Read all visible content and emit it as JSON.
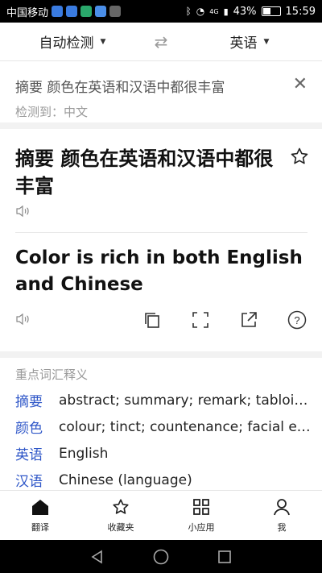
{
  "statusbar": {
    "carrier": "中国移动",
    "signal_tag": "4G",
    "battery": "43%",
    "time": "15:59",
    "battery_level": 0.43
  },
  "lang": {
    "source": "自动检测",
    "target": "英语"
  },
  "input": {
    "text": "摘要 颜色在英语和汉语中都很丰富",
    "detected": "检测到：中文"
  },
  "result": {
    "source_text": "摘要 颜色在英语和汉语中都很丰富",
    "translation": "Color is rich in both English and Chinese"
  },
  "vocab": {
    "title": "重点词汇释义",
    "items": [
      {
        "word": "摘要",
        "def": "abstract; summary; remark; tabloid;..."
      },
      {
        "word": "颜色",
        "def": "colour; tinct; countenance; facial ex..."
      },
      {
        "word": "英语",
        "def": "English"
      },
      {
        "word": "汉语",
        "def": "Chinese (language)"
      }
    ]
  },
  "nav": {
    "items": [
      {
        "label": "翻译",
        "icon": "home-icon"
      },
      {
        "label": "收藏夹",
        "icon": "star-icon"
      },
      {
        "label": "小应用",
        "icon": "grid-icon"
      },
      {
        "label": "我",
        "icon": "person-icon"
      }
    ]
  },
  "colors": {
    "accent": "#2f57c8",
    "text": "#111111",
    "muted": "#9a9a9a"
  }
}
